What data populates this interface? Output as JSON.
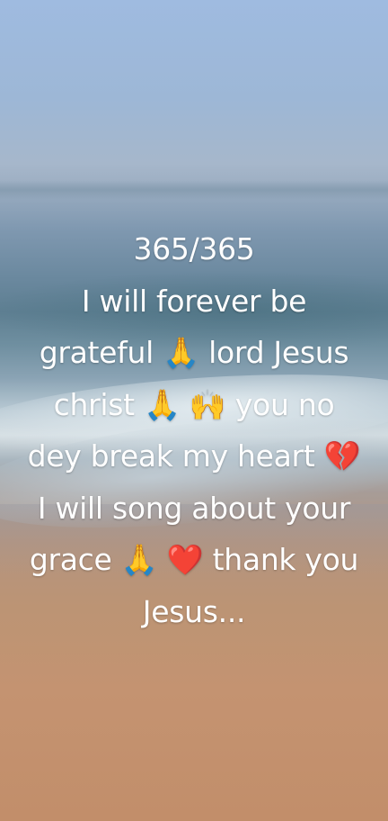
{
  "caption": {
    "lines": [
      "365/365",
      "I will forever be",
      "grateful 🙏 lord Jesus",
      "christ 🙏 🙌 you no",
      "dey break my heart 💔",
      "I will song about your",
      "grace 🙏 ❤️ thank you",
      "Jesus..."
    ],
    "color": "#ffffff"
  },
  "background": {
    "description_colors": {
      "sky": "#9fbbe0",
      "sea": "#6a889e",
      "foam": "#e8eff2",
      "sand": "#c49371"
    }
  }
}
